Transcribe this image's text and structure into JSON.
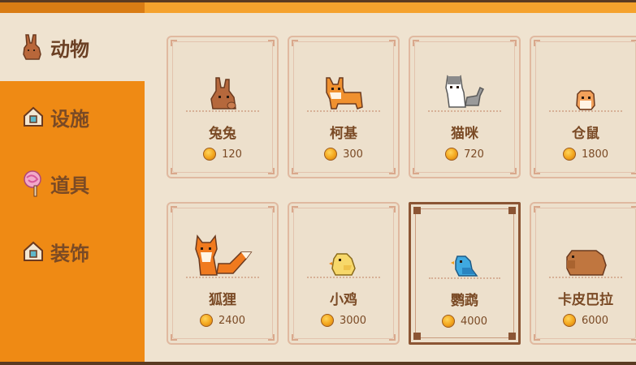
{
  "sidebar": {
    "items": [
      {
        "label": "动物",
        "icon": "rabbit-icon",
        "active": true
      },
      {
        "label": "设施",
        "icon": "house-icon",
        "active": false
      },
      {
        "label": "道具",
        "icon": "lollipop-icon",
        "active": false
      },
      {
        "label": "装饰",
        "icon": "house-icon",
        "active": false
      }
    ]
  },
  "shop": {
    "cards": [
      {
        "name": "兔兔",
        "price": "120",
        "icon": "rabbit-sprite"
      },
      {
        "name": "柯基",
        "price": "300",
        "icon": "corgi-sprite"
      },
      {
        "name": "猫咪",
        "price": "720",
        "icon": "cat-sprite"
      },
      {
        "name": "仓鼠",
        "price": "1800",
        "icon": "hamster-sprite"
      },
      {
        "name": "狐狸",
        "price": "2400",
        "icon": "fox-sprite"
      },
      {
        "name": "小鸡",
        "price": "3000",
        "icon": "chick-sprite"
      },
      {
        "name": "鹦鹉",
        "price": "4000",
        "icon": "parrot-sprite",
        "selected": true
      },
      {
        "name": "卡皮巴拉",
        "price": "6000",
        "icon": "capybara-sprite"
      }
    ]
  },
  "colors": {
    "sidebar_bg": "#ef8a14",
    "active_bg": "#efe3d0",
    "text_brown": "#7a4a25",
    "accent_bar": "#f5a22d"
  }
}
